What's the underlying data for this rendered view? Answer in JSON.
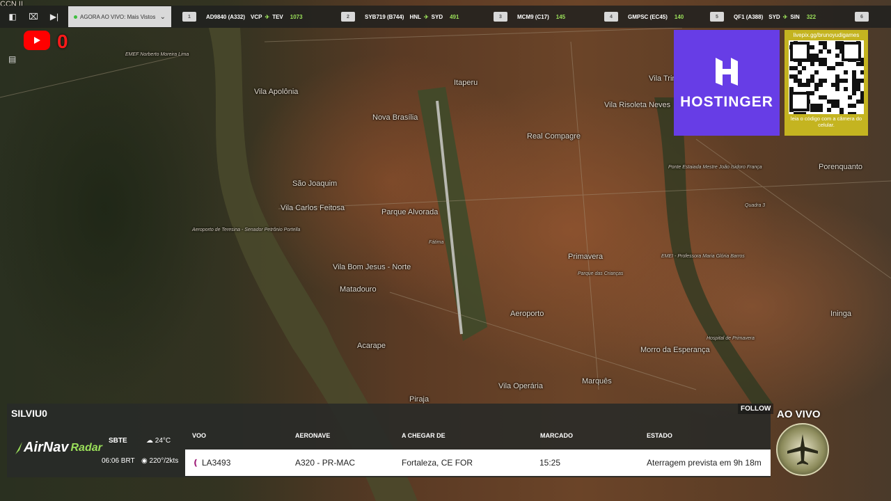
{
  "map": {
    "labels": [
      {
        "t": "Vila Apolônia"
      },
      {
        "t": "Nova Brasília"
      },
      {
        "t": "Itaperu"
      },
      {
        "t": "São Joaquim"
      },
      {
        "t": "Vila Carlos Feitosa"
      },
      {
        "t": "Parque Alvorada"
      },
      {
        "t": "Vila Bom Jesus - Norte"
      },
      {
        "t": "Matadouro"
      },
      {
        "t": "Acarape"
      },
      {
        "t": "Real Compagre"
      },
      {
        "t": "Primavera"
      },
      {
        "t": "Aeroporto"
      },
      {
        "t": "Vila Operária"
      },
      {
        "t": "Marquês"
      },
      {
        "t": "Morro da Esperança"
      },
      {
        "t": "Vila Trindade"
      },
      {
        "t": "Vila Risoleta Neves"
      },
      {
        "t": "Piraja"
      },
      {
        "t": "Porenquanto"
      },
      {
        "t": "Ininga"
      },
      {
        "t": "Fátima"
      },
      {
        "t": "Aeroporto de Teresina - Senador Petrônio Portella"
      },
      {
        "t": "EMEF Norberto Moreira Lima"
      },
      {
        "t": "EMEI - Professora Maria Glória Barros"
      },
      {
        "t": "Parque das Crianças"
      },
      {
        "t": "Hospital de Primavera"
      },
      {
        "t": "Ponte Estaiada Mestre João Isidoro França"
      },
      {
        "t": "Quadra 3"
      },
      {
        "t": "CCN II"
      }
    ]
  },
  "topbar": {
    "dropdown_label": "AGORA AO VIVO: Mais Vistos",
    "flights": [
      {
        "num": "1",
        "callsign": "AD9840 (A332)",
        "route_from": "VCP",
        "route_to": "TEV",
        "speed": "1073"
      },
      {
        "num": "2",
        "callsign": "SYB719 (B744)",
        "route_from": "HNL",
        "route_to": "SYD",
        "speed": "491"
      },
      {
        "num": "3",
        "callsign": "MCM9 (C17)",
        "route_from": "",
        "route_to": "",
        "speed": "145"
      },
      {
        "num": "4",
        "callsign": "GMPSC (EC45)",
        "route_from": "",
        "route_to": "",
        "speed": "140"
      },
      {
        "num": "5",
        "callsign": "QF1 (A388)",
        "route_from": "SYD",
        "route_to": "SIN",
        "speed": "322"
      },
      {
        "num": "6",
        "callsign": "",
        "route_from": "",
        "route_to": "",
        "speed": ""
      }
    ]
  },
  "youtube": {
    "count": "0"
  },
  "sponsor": {
    "brand": "HOSTINGER",
    "url": "livepix.gg/brunoyudigames",
    "qr_caption": "leia o código com a câmera do celular."
  },
  "panel": {
    "callsign": "SILVIU0",
    "follow_label": "FOLLOW",
    "logo_airnav": "AirNav",
    "logo_radar": "Radar",
    "station": "SBTE",
    "time": "06:06 BRT",
    "temp": "24°C",
    "wind": "220°/2kts",
    "headers": {
      "voo": "VOO",
      "aeronave": "AERONAVE",
      "origem": "A CHEGAR DE",
      "marcado": "MARCADO",
      "estado": "ESTADO"
    },
    "row": {
      "voo": "LA3493",
      "aeronave": "A320 - PR-MAC",
      "origem": "Fortaleza, CE FOR",
      "marcado": "15:25",
      "estado": "Aterragem prevista em 9h 18m"
    }
  },
  "live_badge": "AO VIVO",
  "colors": {
    "accent": "#9be05a",
    "hostinger": "#673de6",
    "youtube": "#ff0000"
  }
}
